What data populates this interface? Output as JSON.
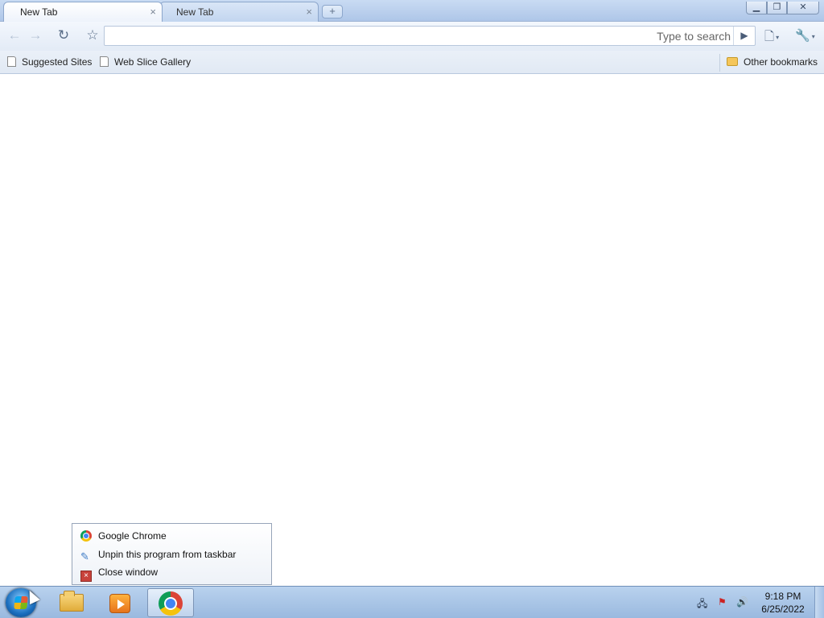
{
  "tabs": [
    {
      "label": "New Tab",
      "close": "×",
      "active": true
    },
    {
      "label": "New Tab",
      "close": "×",
      "active": false
    }
  ],
  "new_tab_symbol": "+",
  "window_controls": {
    "minimize": "▁",
    "maximize": "❐",
    "close": "✕"
  },
  "toolbar": {
    "back": "←",
    "forward": "→",
    "reload": "↻",
    "star": "☆",
    "omnibox_value": "",
    "omnibox_placeholder": "Type to search",
    "go": "▶",
    "page_menu": "🗋",
    "tools_menu": "🔧",
    "caret": "▾"
  },
  "bookmarks": {
    "items": [
      {
        "label": "Suggested Sites",
        "icon": "page-icon"
      },
      {
        "label": "Web Slice Gallery",
        "icon": "page-icon"
      }
    ],
    "other": {
      "label": "Other bookmarks",
      "icon": "folder-icon"
    }
  },
  "jumplist": {
    "items": [
      {
        "label": "Google Chrome",
        "icon": "chrome-icon"
      },
      {
        "label": "Unpin this program from taskbar",
        "icon": "unpin-icon"
      },
      {
        "label": "Close window",
        "icon": "close-window-icon"
      }
    ]
  },
  "taskbar": {
    "clock": {
      "time": "9:18 PM",
      "date": "6/25/2022"
    },
    "tray": {
      "network": "🖧",
      "flag": "⚑",
      "volume": "🔊"
    }
  },
  "colors": {
    "accent": "#4285f4",
    "taskbar": "#9ab9df",
    "tabstrip": "#c9dbf3"
  }
}
